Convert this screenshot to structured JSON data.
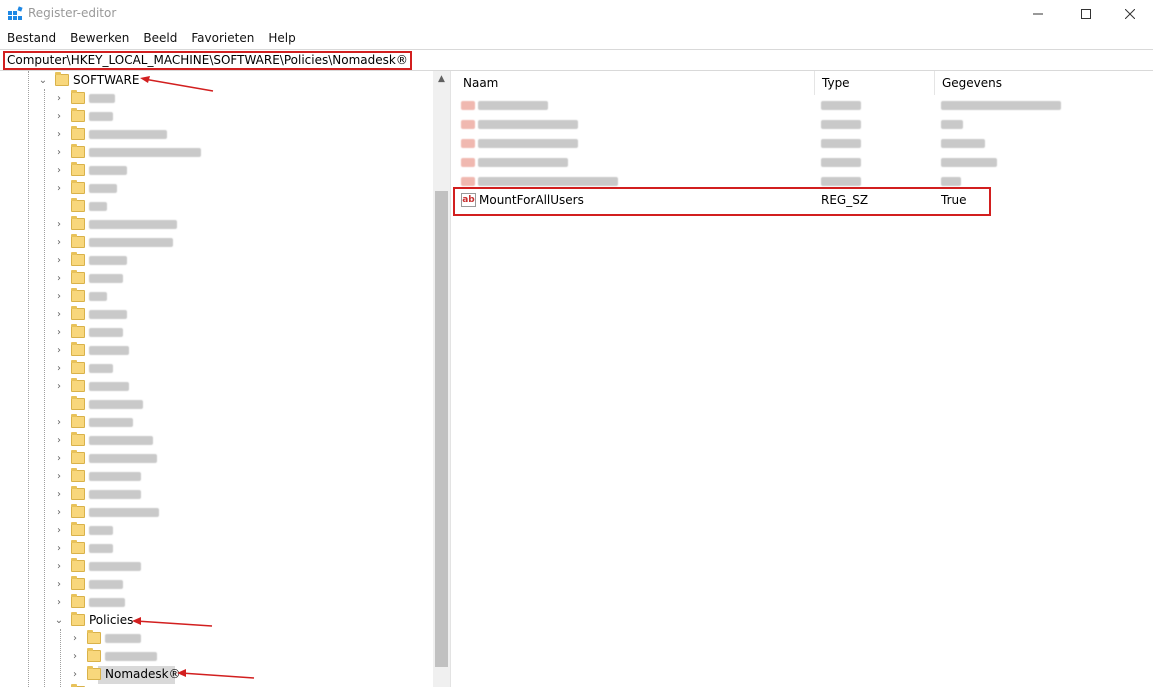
{
  "window": {
    "title": "Register-editor",
    "icon": "registry-editor-icon"
  },
  "menu": [
    "Bestand",
    "Bewerken",
    "Beeld",
    "Favorieten",
    "Help"
  ],
  "address": {
    "path": "Computer\\HKEY_LOCAL_MACHINE\\SOFTWARE\\Policies\\Nomadesk®"
  },
  "tree": {
    "software_label": "SOFTWARE",
    "policies_label": "Policies",
    "nomadesk_label": "Nomadesk®"
  },
  "values": {
    "columns": [
      "Naam",
      "Type",
      "Gegevens"
    ],
    "visible_row": {
      "name": "MountForAllUsers",
      "type": "REG_SZ",
      "data": "True",
      "icon": "reg-string-icon"
    }
  },
  "colors": {
    "annotation_red": "#d21f1f",
    "folder_yellow": "#f8d77c"
  }
}
